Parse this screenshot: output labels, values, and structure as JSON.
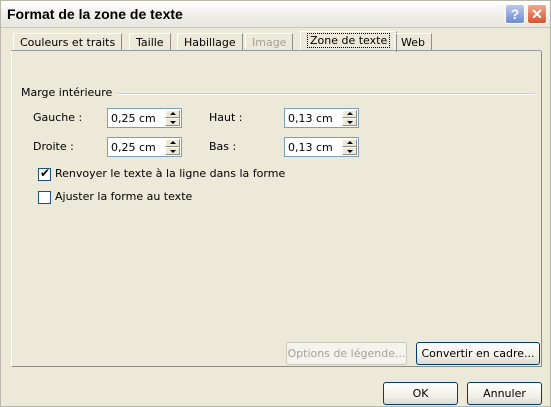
{
  "window": {
    "title": "Format de la zone de texte"
  },
  "title_buttons": {
    "help": "?",
    "close": "✕"
  },
  "tabs": [
    {
      "label": "Couleurs et traits"
    },
    {
      "label": "Taille"
    },
    {
      "label": "Habillage"
    },
    {
      "label": "Image"
    },
    {
      "label": "Zone de texte"
    },
    {
      "label": "Web"
    }
  ],
  "inner_margin": {
    "group_label": "Marge intérieure",
    "left": {
      "label": "Gauche :",
      "value": "0,25 cm"
    },
    "right": {
      "label": "Droite :",
      "value": "0,25 cm"
    },
    "top": {
      "label": "Haut :",
      "value": "0,13 cm"
    },
    "bottom": {
      "label": "Bas :",
      "value": "0,13 cm"
    }
  },
  "options": {
    "wrap_text": {
      "label": "Renvoyer le texte à la ligne dans la forme",
      "checked": true,
      "mark": "✔"
    },
    "fit_shape": {
      "label": "Ajuster la forme au texte",
      "checked": false
    }
  },
  "buttons": {
    "legend_options": "Options de légende...",
    "convert_frame": "Convertir en cadre...",
    "ok": "OK",
    "cancel": "Annuler"
  }
}
